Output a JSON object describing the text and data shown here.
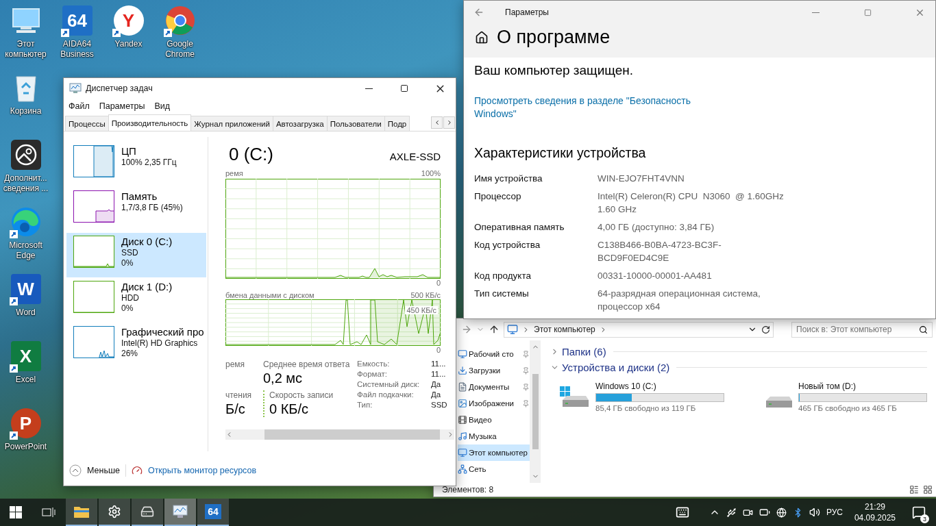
{
  "desktop_icons": [
    {
      "kind": "computer",
      "label": "Этот компьютер",
      "shortcut": false
    },
    {
      "kind": "aida",
      "label": "AIDA64 Business",
      "glyph": "64",
      "shortcut": true
    },
    {
      "kind": "yandex",
      "label": "Yandex",
      "glyph": "Y",
      "shortcut": true
    },
    {
      "kind": "chrome",
      "label": "Google Chrome",
      "shortcut": true
    },
    {
      "kind": "recycle",
      "label": "Корзина",
      "shortcut": false
    },
    {
      "kind": "info",
      "label": "Дополнит... сведения ...",
      "shortcut": false
    },
    {
      "kind": "edge",
      "label": "Microsoft Edge",
      "shortcut": true
    },
    {
      "kind": "word",
      "label": "Word",
      "glyph": "W",
      "shortcut": true
    },
    {
      "kind": "excel",
      "label": "Excel",
      "glyph": "X",
      "shortcut": true
    },
    {
      "kind": "powerpoint",
      "label": "PowerPoint",
      "glyph": "P",
      "shortcut": true
    }
  ],
  "explorer": {
    "address": "Этот компьютер",
    "search_placeholder": "Поиск в: Этот компьютер",
    "nav": [
      {
        "kind": "desktop",
        "label": "Рабочий сто",
        "pinned": true,
        "selected": false
      },
      {
        "kind": "downloads",
        "label": "Загрузки",
        "pinned": true,
        "selected": false
      },
      {
        "kind": "documents",
        "label": "Документы",
        "pinned": true,
        "selected": false
      },
      {
        "kind": "pictures",
        "label": "Изображени",
        "pinned": true,
        "selected": false
      },
      {
        "kind": "video",
        "label": "Видео",
        "pinned": false,
        "selected": false
      },
      {
        "kind": "music",
        "label": "Музыка",
        "pinned": false,
        "selected": false
      },
      {
        "kind": "pc",
        "label": "Этот компьютер",
        "pinned": false,
        "selected": true
      },
      {
        "kind": "network",
        "label": "Сеть",
        "pinned": false,
        "selected": false
      }
    ],
    "groups": [
      {
        "title": "Папки (6)",
        "expanded": false
      },
      {
        "title": "Устройства и диски (2)",
        "expanded": true,
        "drives": [
          {
            "kind": "system",
            "name": "Windows 10 (C:)",
            "level": 0.28,
            "free": "85,4 ГБ свободно из 119 ГБ"
          },
          {
            "kind": "plain",
            "name": "Новый том (D:)",
            "level": 0,
            "free": "465 ГБ свободно из 465 ГБ"
          }
        ]
      }
    ],
    "status": "Элементов: 8"
  },
  "settings": {
    "title": "Параметры",
    "heading": "О программе",
    "protection": "Ваш компьютер защищен.",
    "security_link": "Просмотреть сведения в разделе \"Безопасность Windows\"",
    "section": "Характеристики устройства",
    "specs": [
      {
        "label": "Имя устройства",
        "value": [
          "WIN-EJO7FHT4VNN"
        ]
      },
      {
        "label": "Процессор",
        "value": [
          "Intel(R) Celeron(R) CPU  N3060  @ 1.60GHz",
          "1.60 GHz"
        ]
      },
      {
        "label": "Оперативная память",
        "value": [
          "4,00 ГБ (доступно: 3,84 ГБ)"
        ]
      },
      {
        "label": "Код устройства",
        "value": [
          "C138B466-B0BA-4723-BC3F-",
          "BCD9F0ED4C9E"
        ]
      },
      {
        "label": "Код продукта",
        "value": [
          "00331-10000-00001-AA481"
        ]
      },
      {
        "label": "Тип системы",
        "value": [
          "64-разрядная операционная система,",
          "процессор x64"
        ]
      }
    ]
  },
  "task_manager": {
    "title": "Диспетчер задач",
    "menu": [
      "Файл",
      "Параметры",
      "Вид"
    ],
    "tabs": [
      {
        "label": "Процессы",
        "selected": false
      },
      {
        "label": "Производительность",
        "selected": true
      },
      {
        "label": "Журнал приложений",
        "selected": false
      },
      {
        "label": "Автозагрузка",
        "selected": false
      },
      {
        "label": "Пользователи",
        "selected": false
      },
      {
        "label": "Подр",
        "selected": false
      }
    ],
    "resources": [
      {
        "kind": "cpu",
        "name": "ЦП",
        "details": [
          "100% 2,35 ГГц"
        ],
        "selected": false
      },
      {
        "kind": "memory",
        "name": "Память",
        "details": [
          "1,7/3,8 ГБ (45%)"
        ],
        "selected": false
      },
      {
        "kind": "disk",
        "name": "Диск 0 (C:)",
        "details": [
          "SSD",
          "0%"
        ],
        "selected": true
      },
      {
        "kind": "disk",
        "name": "Диск 1 (D:)",
        "details": [
          "HDD",
          "0%"
        ],
        "selected": false
      },
      {
        "kind": "gpu",
        "name": "Графический про",
        "details": [
          "Intel(R) HD Graphics",
          "26%"
        ],
        "selected": false
      }
    ],
    "detail": {
      "title": "0 (C:)",
      "model": "AXLE-SSD",
      "active_chart": {
        "label": "ремя",
        "max": "100%",
        "min": "0"
      },
      "transfer_chart": {
        "label": "бмена данными с диском",
        "max": "500 КБ/с",
        "mark": "450 КБ/с",
        "min": "0"
      },
      "stats": [
        {
          "kind": "plain",
          "label": "ремя"
        },
        {
          "kind": "plain",
          "label": "Среднее время ответа",
          "value": "0,2 мс"
        },
        {
          "kind": "plain",
          "label": "чтения",
          "value": "Б/с"
        },
        {
          "kind": "write",
          "label": "Скорость записи",
          "value": "0 КБ/с"
        }
      ],
      "properties": [
        {
          "label": "Емкость:",
          "value": "11..."
        },
        {
          "label": "Формат:",
          "value": "11..."
        },
        {
          "label": "Системный диск:",
          "value": "Да"
        },
        {
          "label": "Файл подкачки:",
          "value": "Да"
        },
        {
          "label": "Тип:",
          "value": "SSD"
        }
      ]
    },
    "footer": {
      "less": "Меньше",
      "monitor_link": "Открыть монитор ресурсов"
    }
  },
  "taskbar": {
    "apps": [
      {
        "kind": "explorer",
        "selected": false
      },
      {
        "kind": "settings",
        "selected": false
      },
      {
        "kind": "drive",
        "selected": false
      },
      {
        "kind": "taskmgr",
        "selected": true
      },
      {
        "kind": "aida",
        "glyph": "64",
        "selected": false
      }
    ],
    "language": "РУС",
    "time": "21:29",
    "date": "04.09.2025",
    "notifications": "3"
  }
}
